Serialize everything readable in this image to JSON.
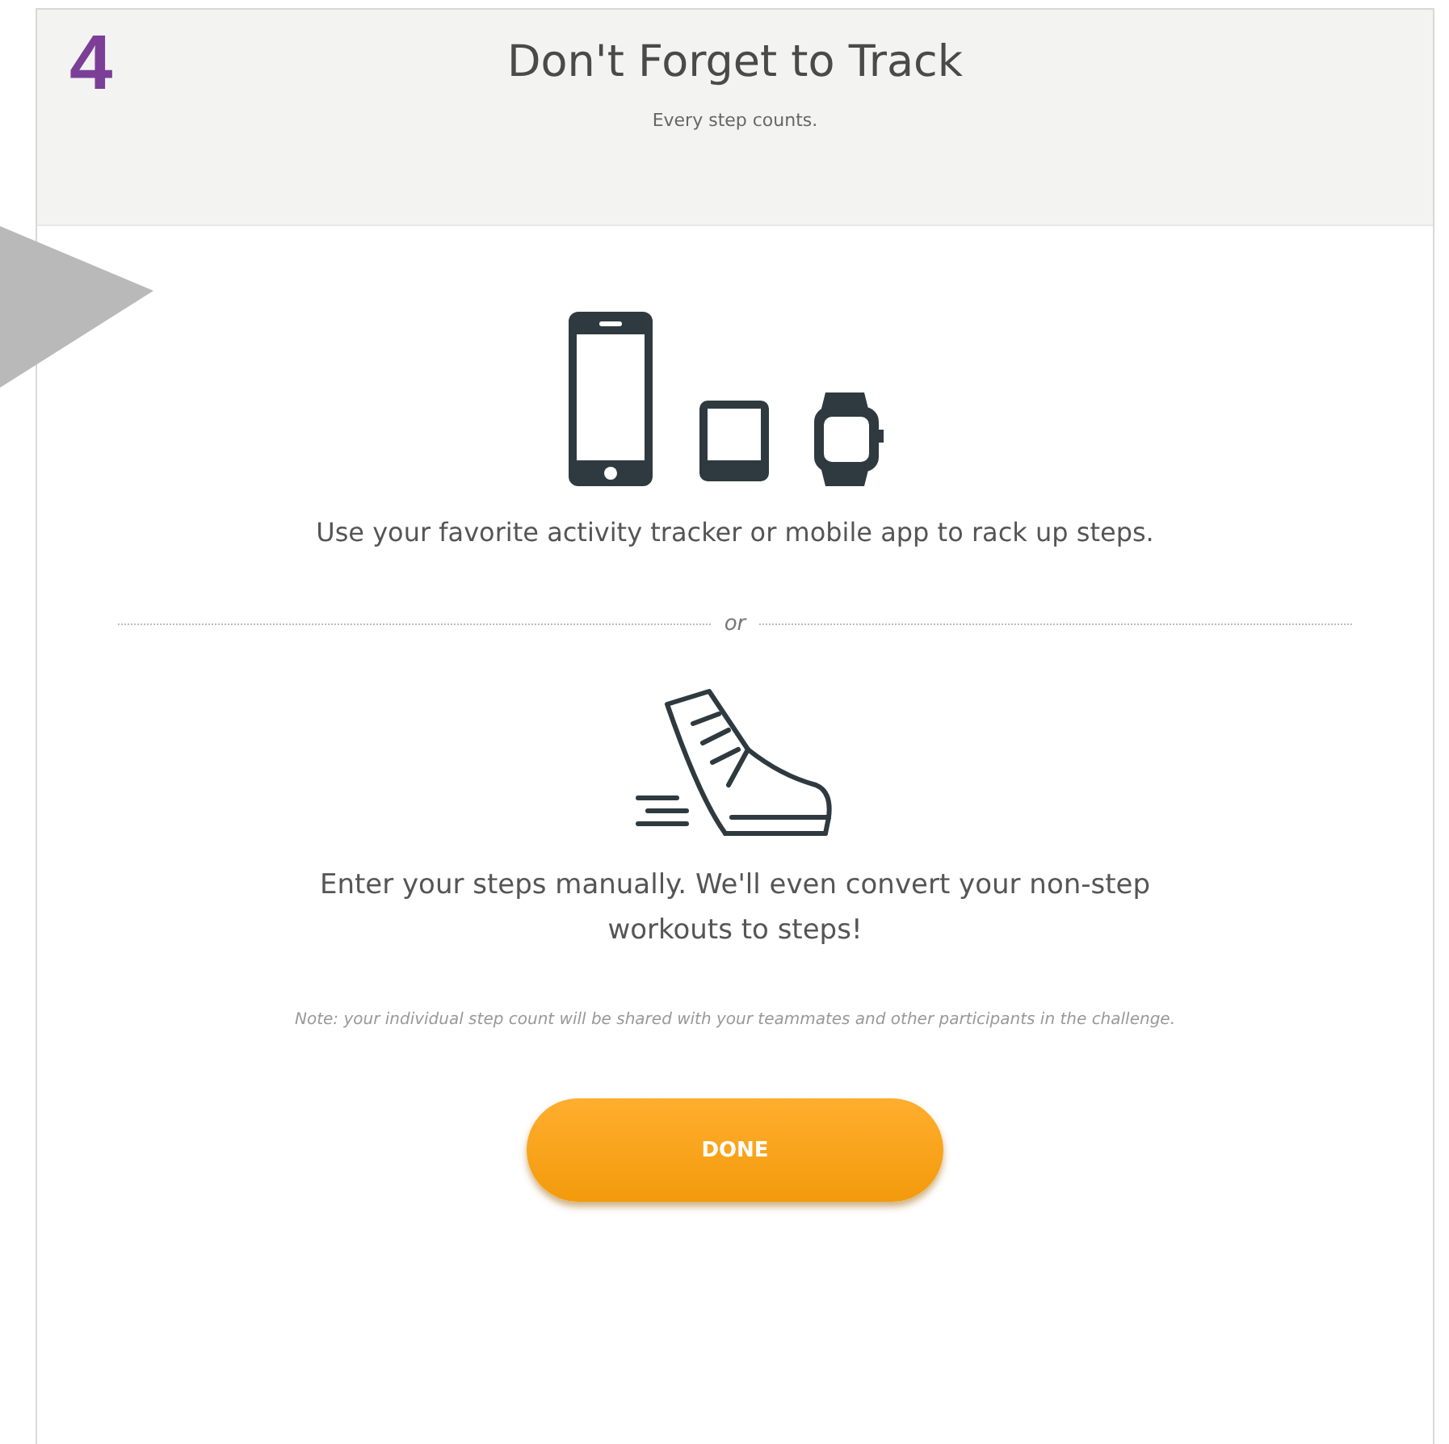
{
  "step_number": "4",
  "header": {
    "title": "Don't Forget to Track",
    "subtitle": "Every step counts."
  },
  "options": [
    {
      "kind": "devices",
      "text": "Use your favorite activity tracker or mobile app to rack up steps."
    },
    {
      "kind": "shoe",
      "text": "Enter your steps manually. We'll even convert your non-step workouts to steps!"
    }
  ],
  "divider_text": "or",
  "note": "Note: your individual step count will be shared with your teammates and other participants in the challenge.",
  "button": "DONE"
}
